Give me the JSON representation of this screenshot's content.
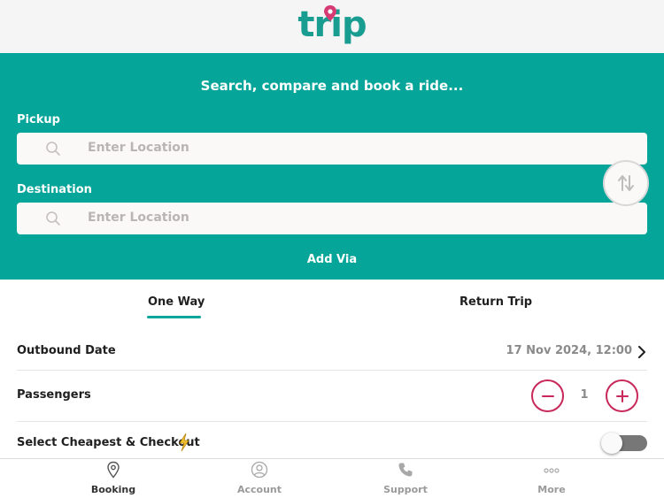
{
  "header": {
    "logo_text": "trip"
  },
  "hero": {
    "tagline": "Search, compare and book a ride...",
    "pickup_label": "Pickup",
    "pickup_placeholder": "Enter Location",
    "destination_label": "Destination",
    "destination_placeholder": "Enter Location",
    "add_via": "Add Via"
  },
  "tabs": [
    {
      "label": "One Way",
      "active": true
    },
    {
      "label": "Return Trip",
      "active": false
    }
  ],
  "outbound": {
    "label": "Outbound Date",
    "value": "17 Nov 2024, 12:00"
  },
  "passengers": {
    "label": "Passengers",
    "count": "1"
  },
  "cheapest": {
    "label": "Select Cheapest & Checkout",
    "enabled": false
  },
  "nav": [
    {
      "label": "Booking",
      "icon": "location-pin-icon",
      "active": true
    },
    {
      "label": "Account",
      "icon": "user-circle-icon",
      "active": false
    },
    {
      "label": "Support",
      "icon": "phone-icon",
      "active": false
    },
    {
      "label": "More",
      "icon": "more-dots-icon",
      "active": false
    }
  ],
  "colors": {
    "brand_teal": "#06a59a",
    "logo_teal": "#1a9d91",
    "accent_pink": "#c8285a"
  }
}
